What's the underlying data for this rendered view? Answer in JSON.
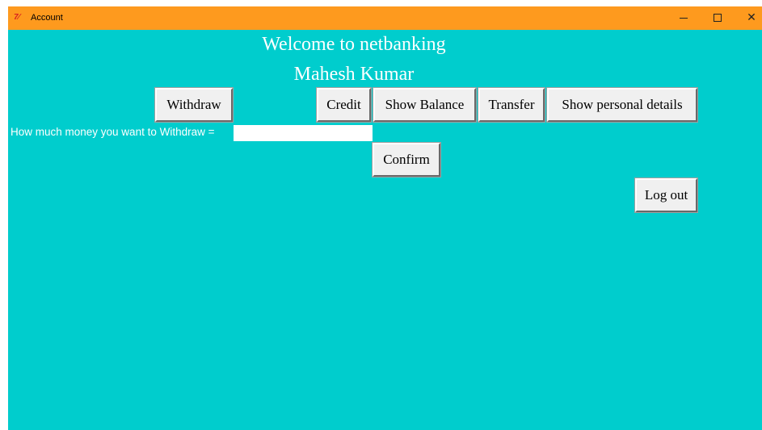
{
  "window": {
    "title": "Account",
    "icon": "tk-feather-icon",
    "icon_label": "7⁄",
    "controls": {
      "minimize_icon": "minimize-icon",
      "maximize_icon": "maximize-icon",
      "close_icon": "close-icon",
      "close_glyph": "✕"
    },
    "colors": {
      "titlebar": "#fe9a1e",
      "background": "#00cdcd",
      "button_face": "#f0f0f0",
      "text_light": "#ffffff"
    }
  },
  "header": {
    "welcome": "Welcome to netbanking",
    "username": "Mahesh Kumar"
  },
  "toolbar": {
    "withdraw_label": "Withdraw",
    "credit_label": "Credit",
    "balance_label": "Show Balance",
    "transfer_label": "Transfer",
    "details_label": "Show personal details"
  },
  "withdraw_form": {
    "prompt": "How much money you want to Withdraw =",
    "amount_value": "",
    "confirm_label": "Confirm"
  },
  "logout_label": "Log out"
}
